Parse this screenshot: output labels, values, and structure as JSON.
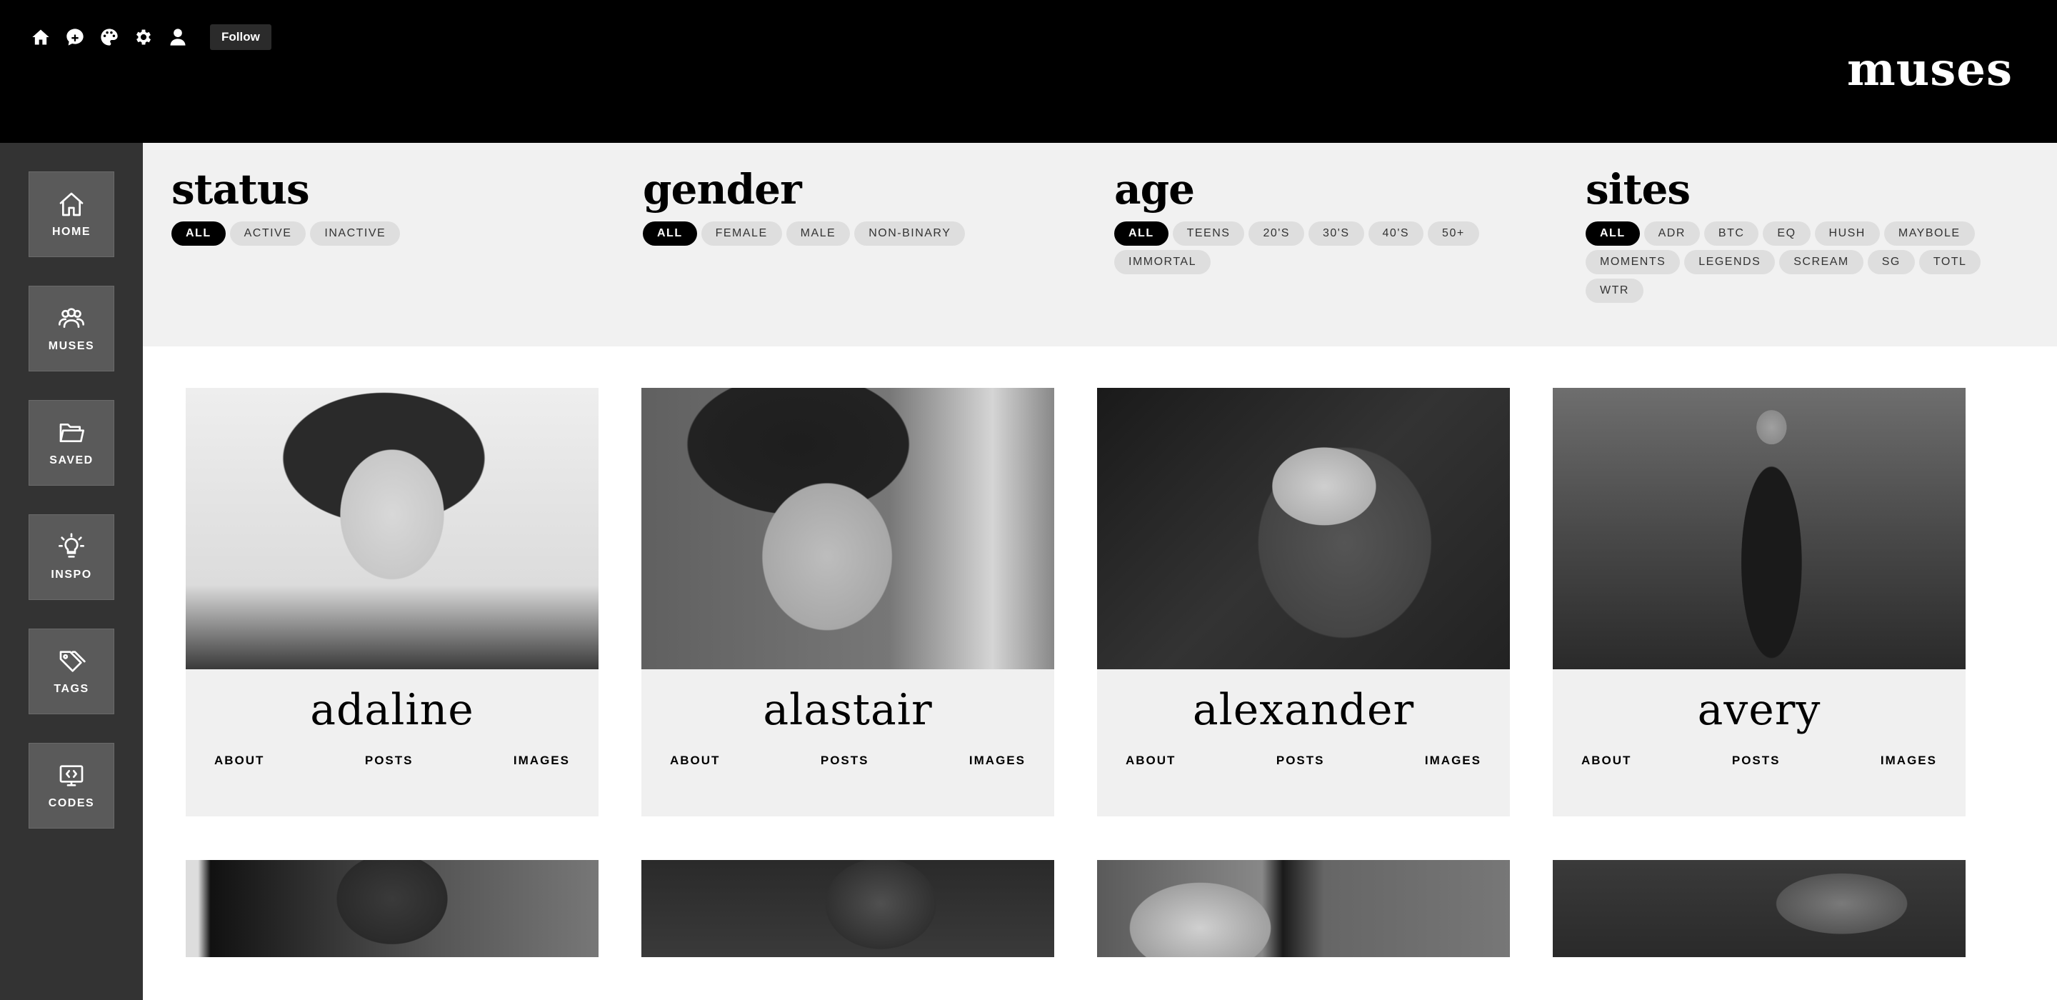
{
  "header": {
    "icons": [
      "home-icon",
      "chat-plus-icon",
      "palette-icon",
      "gear-icon",
      "user-icon"
    ],
    "follow_label": "Follow",
    "site_title": "muses"
  },
  "sidebar": {
    "items": [
      {
        "label": "HOME",
        "icon": "home-icon"
      },
      {
        "label": "MUSES",
        "icon": "users-icon"
      },
      {
        "label": "SAVED",
        "icon": "folder-icon"
      },
      {
        "label": "INSPO",
        "icon": "lightbulb-icon"
      },
      {
        "label": "TAGS",
        "icon": "tags-icon"
      },
      {
        "label": "CODES",
        "icon": "code-icon"
      }
    ]
  },
  "filters": {
    "status": {
      "title": "status",
      "options": [
        "ALL",
        "ACTIVE",
        "INACTIVE"
      ],
      "selected": "ALL"
    },
    "gender": {
      "title": "gender",
      "options": [
        "ALL",
        "FEMALE",
        "MALE",
        "NON-BINARY"
      ],
      "selected": "ALL"
    },
    "age": {
      "title": "age",
      "options": [
        "ALL",
        "TEENS",
        "20'S",
        "30'S",
        "40'S",
        "50+",
        "IMMORTAL"
      ],
      "selected": "ALL"
    },
    "sites": {
      "title": "sites",
      "options": [
        "ALL",
        "ADR",
        "BTC",
        "EQ",
        "HUSH",
        "MAYBOLE",
        "MOMENTS",
        "LEGENDS",
        "SCREAM",
        "SG",
        "TOTL",
        "WTR"
      ],
      "selected": "ALL"
    }
  },
  "muses": [
    {
      "name": "adaline",
      "about": "ABOUT",
      "posts": "POSTS",
      "images": "IMAGES"
    },
    {
      "name": "alastair",
      "about": "ABOUT",
      "posts": "POSTS",
      "images": "IMAGES"
    },
    {
      "name": "alexander",
      "about": "ABOUT",
      "posts": "POSTS",
      "images": "IMAGES"
    },
    {
      "name": "avery",
      "about": "ABOUT",
      "posts": "POSTS",
      "images": "IMAGES"
    }
  ],
  "colors": {
    "header_bg": "#000000",
    "sidebar_bg": "#333333",
    "sidebar_tile": "#5a5a5a",
    "filter_bg": "#f1f1f1",
    "chip_bg": "#dedede",
    "chip_active_bg": "#000000",
    "card_bg": "#f0f0f0"
  }
}
